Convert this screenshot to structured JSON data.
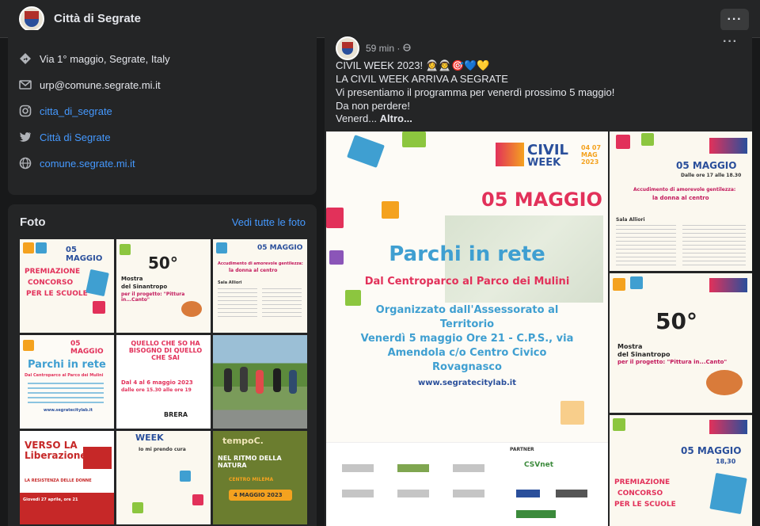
{
  "header": {
    "title": "Città di Segrate",
    "more_label": "···"
  },
  "intro": {
    "address": "Via 1° maggio, Segrate, Italy",
    "email": "urp@comune.segrate.mi.it",
    "instagram": "citta_di_segrate",
    "twitter": "Città di Segrate",
    "website": "comune.segrate.mi.it"
  },
  "photos": {
    "title": "Foto",
    "see_all": "Vedi tutte le foto",
    "tiles": [
      {
        "heading": "05 MAGGIO",
        "line1": "PREMIAZIONE",
        "line2": "CONCORSO",
        "line3": "PER LE SCUOLE"
      },
      {
        "heading": "50°",
        "line1": "Mostra",
        "line2": "del Sinantropo",
        "line3": "per il progetto: \"Pittura in...Canto\""
      },
      {
        "heading": "05 MAGGIO",
        "line1": "Accudimento di amorevole gentilezza:",
        "line2": "la donna al centro",
        "line3": "Sala Alliori"
      },
      {
        "heading": "05 MAGGIO",
        "line1": "Parchi in rete",
        "line2": "Dal Centroparco al Parco dei Mulini",
        "line3": "www.segratecitylab.it"
      },
      {
        "heading": "QUELLO CHE SO HA BISOGNO DI QUELLO CHE SAI",
        "line1": "Dal 4 al 6 maggio 2023",
        "line2": "dalle ore 15.30 alle ore 19",
        "line3": "BRERA"
      },
      {
        "heading": "",
        "line1": "",
        "line2": "",
        "line3": ""
      },
      {
        "heading": "VERSO LA Liberazione",
        "line1": "LA RESISTENZA DELLE DONNE",
        "line2": "Giovedì 27 aprile, ore 21",
        "line3": ""
      },
      {
        "heading": "WEEK",
        "line1": "Io mi prendo cura",
        "line2": "",
        "line3": ""
      },
      {
        "heading": "tempoC.",
        "line1": "NEL RITMO DELLA NATURA",
        "line2": "CENTRO MILEMA",
        "line3": "4 MAGGIO 2023"
      }
    ]
  },
  "post": {
    "time": "59 min · ",
    "more_label": "···",
    "lines": [
      "CIVIL WEEK 2023! 👩‍🚀👨‍🚀🎯💙💛",
      "LA CIVIL WEEK ARRIVA A SEGRATE",
      "Vi presentiamo il programma per venerdì prossimo 5 maggio!",
      "Da non perdere!"
    ],
    "truncated": "Venerd... ",
    "see_more": "Altro...",
    "main_image": {
      "date": "05 MAGGIO",
      "brand1": "CIVIL",
      "brand2": "WEEK",
      "brand_dates": "04 07 MAG 2023",
      "title": "Parchi in rete",
      "subtitle": "Dal Centroparco al Parco dei Mulini",
      "org1": "Organizzato dall'Assessorato al",
      "org2": "Territorio",
      "when1": "Venerdì 5 maggio Ore 21 - C.P.S., via",
      "when2": "Amendola c/o Centro Civico",
      "when3": "Rovagnasco",
      "url": "www.segratecitylab.it",
      "partners": "PARTNER",
      "sponsor": "CSVnet"
    },
    "side_images": [
      {
        "heading": "05 MAGGIO",
        "sub": "Dalle ore 17 alle 18.30",
        "body1": "Accudimento di amorevole gentilezza:",
        "body2": "la donna al centro",
        "body3": "Sala Alliori"
      },
      {
        "heading": "50°",
        "sub": "Mostra",
        "body1": "del Sinantropo",
        "body2": "per il progetto: \"Pittura in...Canto\"",
        "body3": ""
      },
      {
        "heading": "05 MAGGIO",
        "sub": "18,30",
        "body1": "PREMIAZIONE",
        "body2": "CONCORSO",
        "body3": "PER LE SCUOLE"
      }
    ]
  },
  "colors": {
    "accent_link": "#4599ff",
    "brand_blue": "#3f9fd1",
    "brand_red": "#e2315a",
    "brand_orange": "#f4a21f",
    "brand_green": "#8cc63f"
  }
}
